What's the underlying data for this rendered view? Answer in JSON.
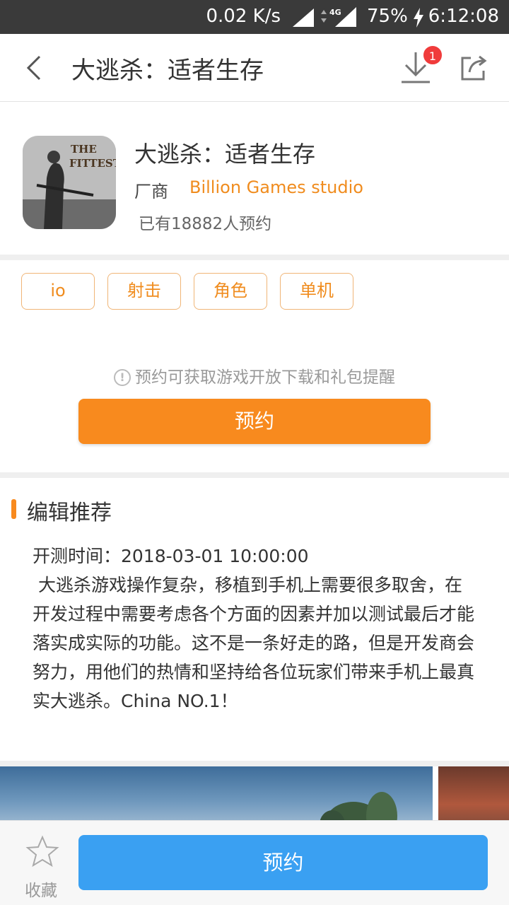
{
  "status_bar": {
    "net_speed": "0.02 K/s",
    "network": "4G",
    "battery": "75%",
    "time": "6:12:08"
  },
  "header": {
    "title": "大逃杀：适者生存",
    "download_badge": "1",
    "icons": [
      "back-arrow-icon",
      "download-icon",
      "share-icon"
    ]
  },
  "app": {
    "name": "大逃杀：适者生存",
    "icon_text_line1": "THE",
    "icon_text_line2": "FITTEST",
    "vendor_label": "厂商",
    "vendor_name": "Billion Games studio",
    "reserve_count": "已有18882人预约"
  },
  "tags": [
    "io",
    "射击",
    "角色",
    "单机"
  ],
  "reserve": {
    "hint": "预约可获取游戏开放下载和礼包提醒",
    "button_label": "预约"
  },
  "editor": {
    "section_title": "编辑推荐",
    "test_time": "开测时间：2018-03-01 10:00:00",
    "description": " 大逃杀游戏操作复杂，移植到手机上需要很多取舍，在开发过程中需要考虑各个方面的因素并加以测试最后才能落实成实际的功能。这不是一条好走的路，但是开发商会努力，用他们的热情和坚持给各位玩家们带来手机上最真实大逃杀。China NO.1！"
  },
  "bottom_bar": {
    "favorite_label": "收藏",
    "button_label": "预约"
  },
  "colors": {
    "accent_orange": "#f88a1e",
    "accent_blue": "#3aa0f2",
    "badge_red": "#f03b3b"
  }
}
